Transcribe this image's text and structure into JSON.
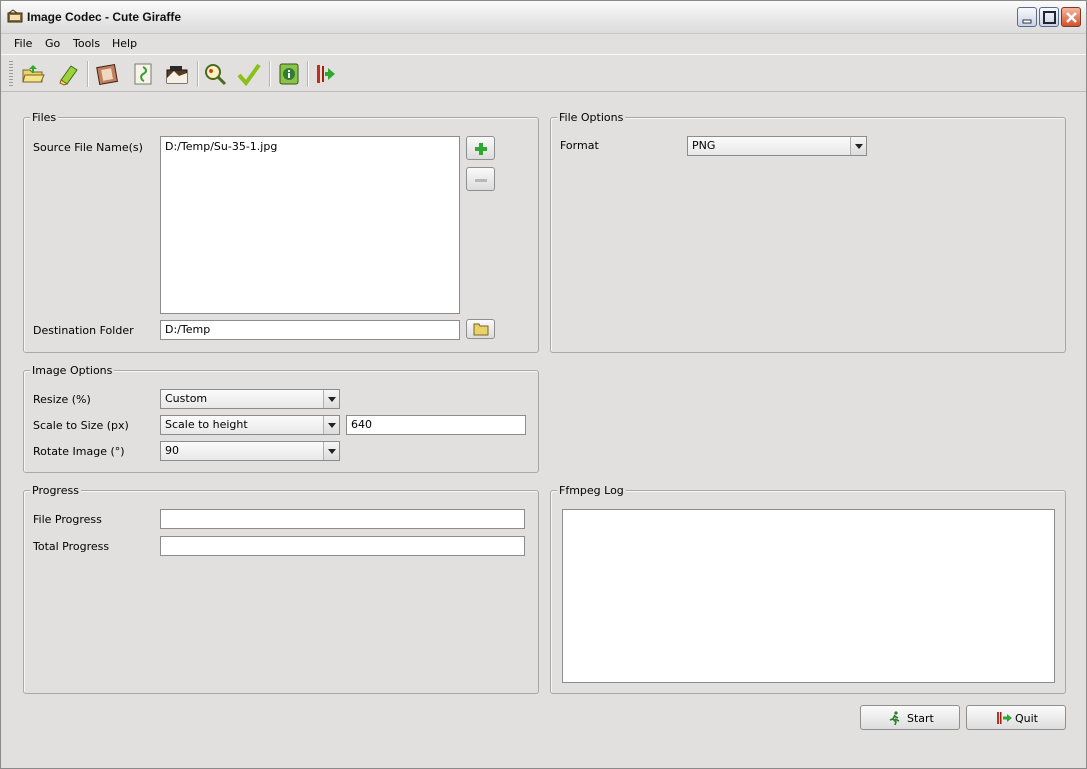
{
  "window": {
    "title": "Image Codec - Cute Giraffe"
  },
  "menu": {
    "items": [
      "File",
      "Go",
      "Tools",
      "Help"
    ]
  },
  "toolbar": {
    "icons": [
      "open-folder-icon",
      "clear-eraser-icon",
      "video-film-icon",
      "audio-music-icon",
      "image-icon",
      "search-magnifier-icon",
      "check-icon",
      "info-icon",
      "exit-icon"
    ]
  },
  "files": {
    "title": "Files",
    "source_label": "Source File Name(s)",
    "source_items": [
      "D:/Temp/Su-35-1.jpg"
    ],
    "destination_label": "Destination Folder",
    "destination_value": "D:/Temp"
  },
  "file_options": {
    "title": "File Options",
    "format_label": "Format",
    "format_value": "PNG"
  },
  "image_options": {
    "title": "Image Options",
    "resize_label": "Resize (%)",
    "resize_value": "Custom",
    "scale_label": "Scale to Size (px)",
    "scale_value": "Scale to height",
    "scale_size": "640",
    "rotate_label": "Rotate Image (°)",
    "rotate_value": "90"
  },
  "progress": {
    "title": "Progress",
    "file_label": "File Progress",
    "file_value": 0,
    "total_label": "Total Progress",
    "total_value": 0
  },
  "log": {
    "title": "Ffmpeg Log",
    "content": ""
  },
  "actions": {
    "start_label": "Start",
    "quit_label": "Quit"
  },
  "colors": {
    "accent_green": "#2fa82f",
    "close_red": "#d4502c"
  }
}
